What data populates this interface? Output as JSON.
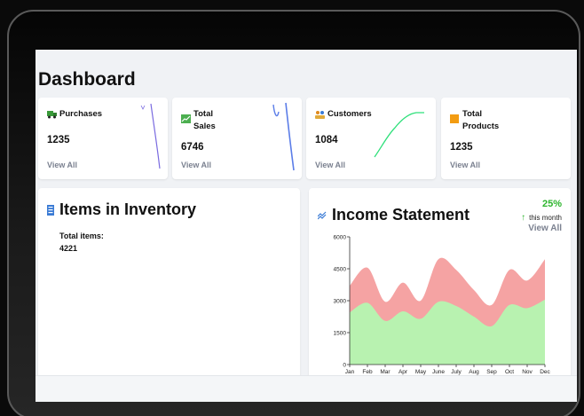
{
  "page": {
    "title": "Dashboard"
  },
  "stats": [
    {
      "label": "Purchases",
      "value": "1235",
      "link": "View All",
      "icon": "truck-icon",
      "color": "#3a9a3a"
    },
    {
      "label": "Total Sales",
      "value": "6746",
      "link": "View All",
      "icon": "sales-chart-icon",
      "color": "#4caf50"
    },
    {
      "label": "Customers",
      "value": "1084",
      "link": "View All",
      "icon": "customers-icon",
      "color": "#e08a1e"
    },
    {
      "label": "Total Products",
      "value": "1235",
      "link": "View All",
      "icon": "box-icon",
      "color": "#f39c12"
    }
  ],
  "inventory": {
    "title": "Items in Inventory",
    "total_label": "Total items:",
    "total_value": "4221",
    "icon": "inventory-icon"
  },
  "income": {
    "title": "Income Statement",
    "percent": "25%",
    "period": "this month",
    "link": "View All",
    "icon": "income-icon",
    "arrow": "↑"
  },
  "chart_data": {
    "type": "area",
    "x": [
      "Jan",
      "Feb",
      "Mar",
      "Apr",
      "May",
      "June",
      "July",
      "Aug",
      "Sep",
      "Oct",
      "Nov",
      "Dec"
    ],
    "series": [
      {
        "values": [
          2450,
          2900,
          2050,
          2500,
          2150,
          2950,
          2750,
          2250,
          1800,
          2800,
          2650,
          3050
        ],
        "color": "#b8f2b0"
      },
      {
        "values": [
          3700,
          4550,
          2950,
          3850,
          3000,
          4950,
          4450,
          3500,
          2800,
          4450,
          3950,
          4950
        ],
        "color": "#f5a3a3"
      }
    ],
    "y_ticks": [
      0,
      1500,
      3000,
      4500,
      6000
    ],
    "ylim": [
      0,
      6000
    ],
    "grid": false
  }
}
